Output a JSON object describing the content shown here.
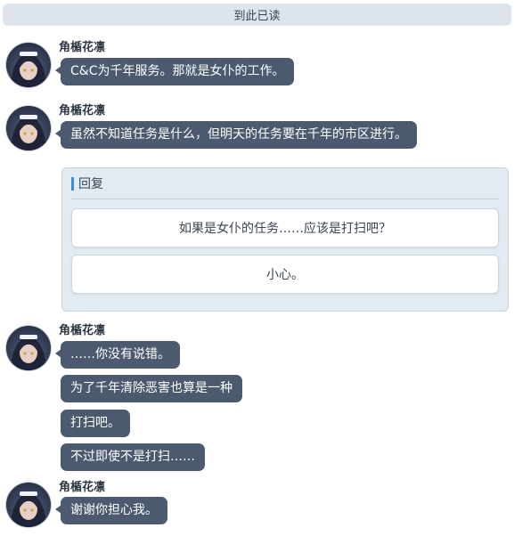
{
  "divider": {
    "label": "到此已读"
  },
  "groups": [
    {
      "sender": "角楯花凛",
      "messages": [
        "C&C为千年服务。那就是女仆的工作。"
      ]
    },
    {
      "sender": "角楯花凛",
      "messages": [
        "虽然不知道任务是什么，但明天的任务要在千年的市区进行。"
      ]
    },
    {
      "sender": "角楯花凛",
      "messages": [
        "……你没有说错。",
        "为了千年清除恶害也算是一种",
        "打扫吧。",
        "不过即使不是打扫……"
      ]
    },
    {
      "sender": "角楯花凛",
      "messages": [
        "谢谢你担心我。"
      ]
    }
  ],
  "reply": {
    "title": "回复",
    "options": [
      "如果是女仆的任务……应该是打扫吧？",
      "小心。"
    ]
  },
  "colors": {
    "bubble": "#4b5a6e",
    "divider_bg": "#dde4ec",
    "reply_panel_bg": "#e3ebf2",
    "reply_accent": "#3a8ed8"
  },
  "icons": {
    "avatar": "character-portrait-icon"
  }
}
